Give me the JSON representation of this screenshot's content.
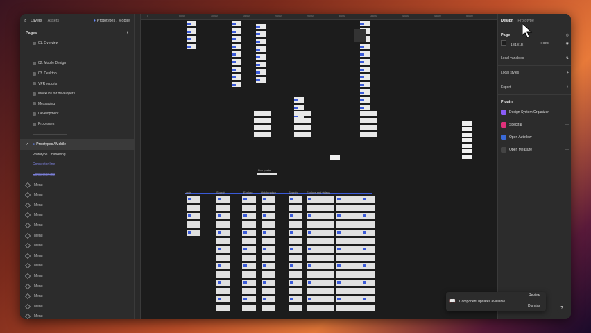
{
  "left_panel": {
    "tabs": [
      "Layers",
      "Assets"
    ],
    "project": "Prototypes / Mobile",
    "pages_title": "Pages",
    "pages": [
      {
        "label": "01. Overview",
        "type": "page"
      },
      {
        "label": "——————————",
        "type": "sep"
      },
      {
        "label": "02. Mobile Design",
        "type": "page"
      },
      {
        "label": "03. Desktop",
        "type": "page"
      },
      {
        "label": "VPR reports",
        "type": "page"
      },
      {
        "label": "Mockups for developers",
        "type": "page"
      },
      {
        "label": "Messaging",
        "type": "page"
      },
      {
        "label": "Development",
        "type": "page"
      },
      {
        "label": "Processes",
        "type": "page"
      },
      {
        "label": "——————————",
        "type": "sep"
      }
    ],
    "selected_page": "Prototypes / Mobile",
    "layers": [
      {
        "label": "Prototype / marketing",
        "type": "plain"
      },
      {
        "label": "Connector line",
        "type": "strike"
      },
      {
        "label": "Connector line",
        "type": "strike"
      },
      {
        "label": "Menu",
        "type": "menu"
      },
      {
        "label": "Menu",
        "type": "menu"
      },
      {
        "label": "Menu",
        "type": "menu"
      },
      {
        "label": "Menu",
        "type": "menu"
      },
      {
        "label": "Menu",
        "type": "menu"
      },
      {
        "label": "Menu",
        "type": "menu"
      },
      {
        "label": "Menu",
        "type": "menu"
      },
      {
        "label": "Menu",
        "type": "menu"
      },
      {
        "label": "Menu",
        "type": "menu"
      },
      {
        "label": "Menu",
        "type": "menu"
      },
      {
        "label": "Menu",
        "type": "menu"
      },
      {
        "label": "Menu",
        "type": "menu"
      },
      {
        "label": "Menu",
        "type": "menu"
      },
      {
        "label": "Menu",
        "type": "menu"
      }
    ]
  },
  "right_panel": {
    "tabs": [
      "Design",
      "Prototype"
    ],
    "page_label": "Page",
    "bg_color": "1E1E1E",
    "opacity": "100%",
    "local_variables": "Local variables",
    "local_styles": "Local styles",
    "export": "Export",
    "plugin_title": "Plugin",
    "plugins": [
      {
        "label": "Design System Organizer",
        "color": "#8a5cf6"
      },
      {
        "label": "Spectral",
        "color": "#e0307a"
      },
      {
        "label": "Open Autoflow",
        "color": "#3a6ad8"
      },
      {
        "label": "Open Measure",
        "color": "#444444"
      }
    ]
  },
  "canvas": {
    "ruler_ticks": [
      "0",
      "5000",
      "10000",
      "15000",
      "20000",
      "25000",
      "30000",
      "35000",
      "40000",
      "45000",
      "50000"
    ],
    "labels": [
      "Login",
      "Search",
      "Explore",
      "Quick notice",
      "Search",
      "Explore and videos",
      "Pop-paste"
    ]
  },
  "toast": {
    "message": "Component updates available",
    "review": "Review",
    "dismiss": "Dismiss"
  },
  "help": "?"
}
